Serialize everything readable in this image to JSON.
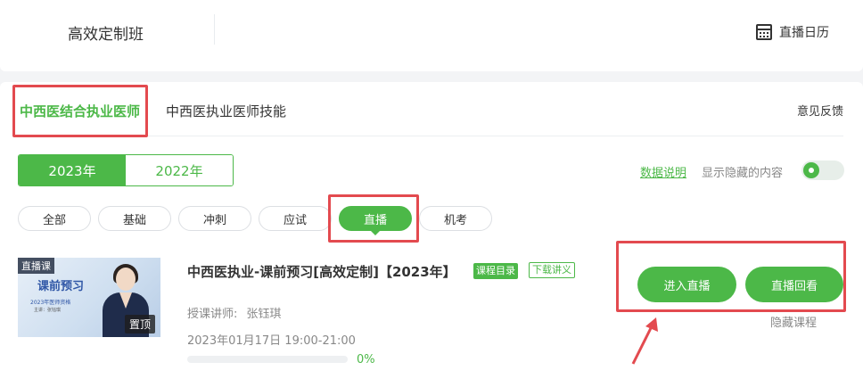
{
  "header": {
    "course_title": "高效定制班",
    "calendar_label": "直播日历"
  },
  "tabs": {
    "active": "中西医结合执业医师",
    "other": "中西医执业医师技能",
    "feedback": "意见反馈"
  },
  "years": [
    "2023年",
    "2022年"
  ],
  "options": {
    "data_explain": "数据说明",
    "show_hidden": "显示隐藏的内容",
    "show_hidden_on": true
  },
  "filters": [
    "全部",
    "基础",
    "冲刺",
    "应试",
    "直播",
    "机考"
  ],
  "course": {
    "thumb_tag": "直播课",
    "thumb_heading": "课前预习",
    "thumb_sub1": "2023年医师资格",
    "thumb_sub2": "主讲：张钰琪",
    "pin": "置顶",
    "name": "中西医执业-课前预习[高效定制]【2023年】",
    "catalog_badge": "课程目录",
    "handout_badge": "下载讲义",
    "teacher_label": "授课讲师:",
    "teacher_name": "张钰琪",
    "datetime": "2023年01月17日 19:00-21:00",
    "progress_value": 0,
    "progress_text": "0%",
    "enter_live": "进入直播",
    "replay": "直播回看",
    "hide": "隐藏课程"
  },
  "colors": {
    "brand_green": "#4cb848",
    "highlight_red": "#e34a4f"
  }
}
